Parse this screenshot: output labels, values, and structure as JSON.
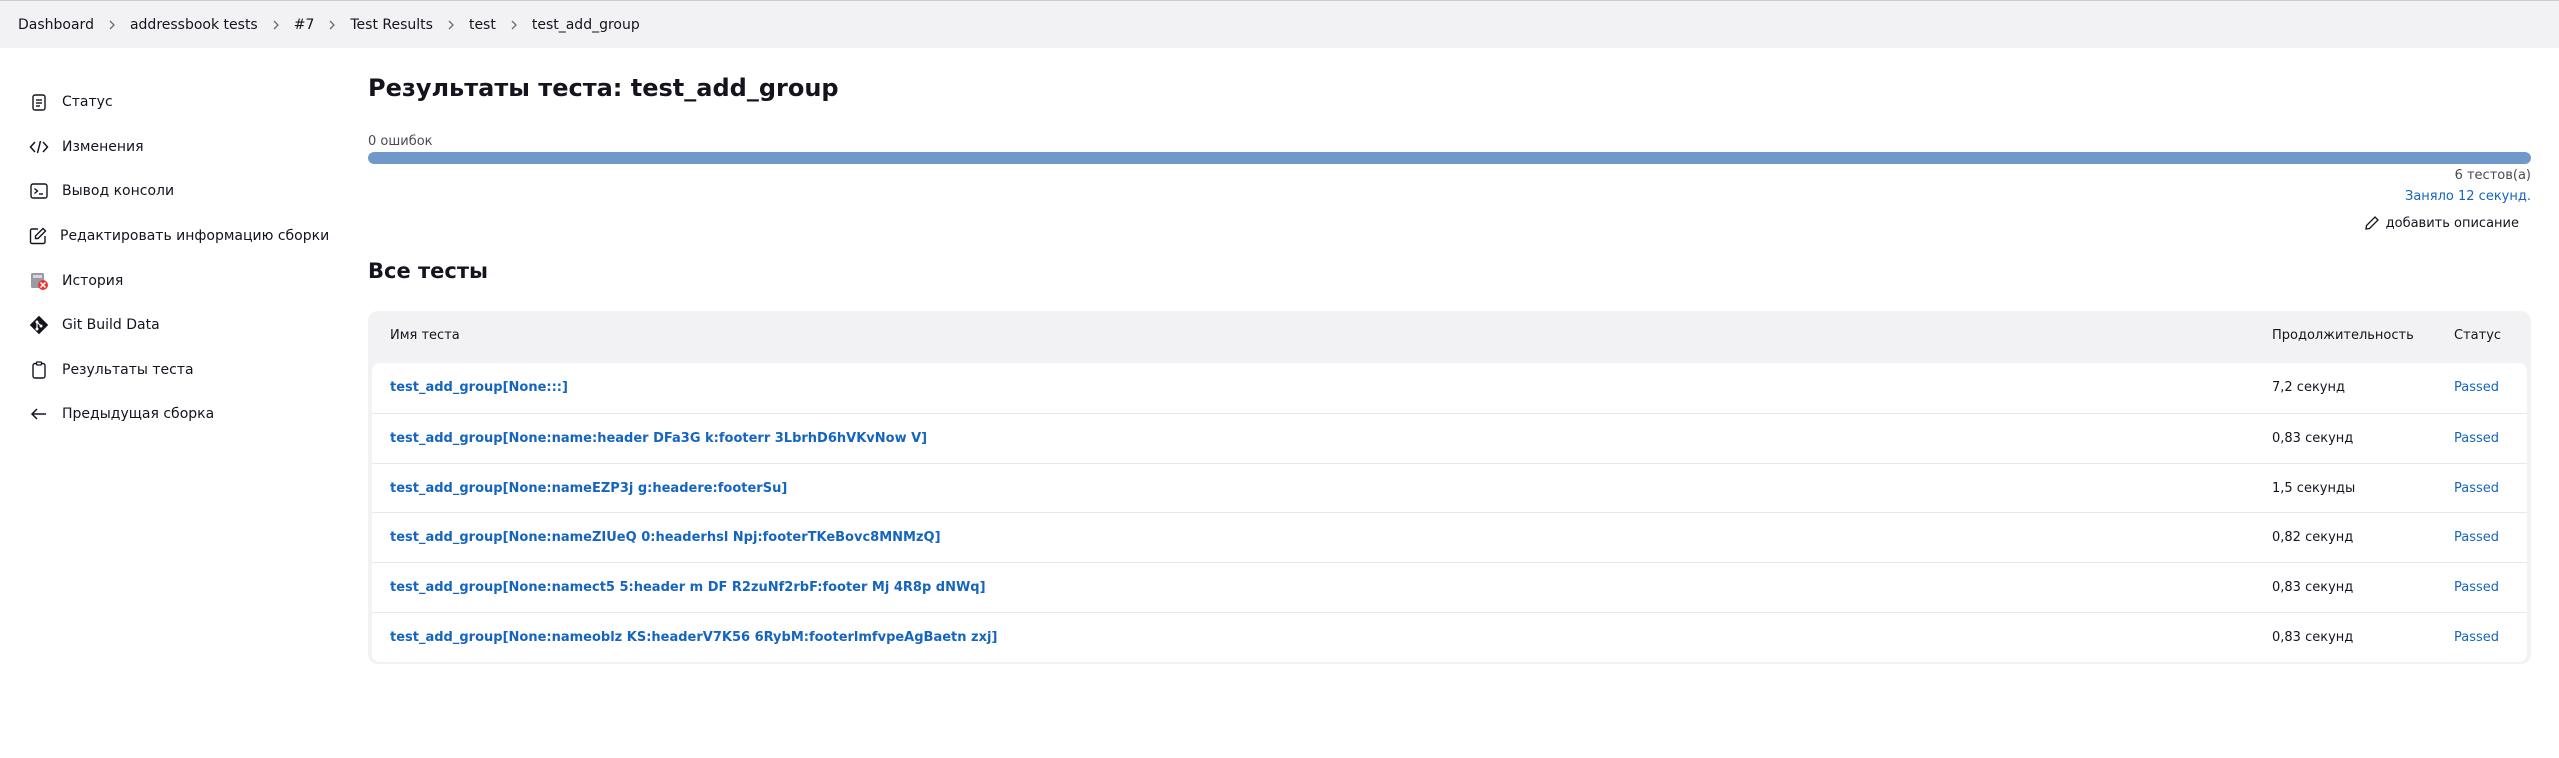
{
  "breadcrumb": [
    "Dashboard",
    "addressbook tests",
    "#7",
    "Test Results",
    "test",
    "test_add_group"
  ],
  "sidebar": {
    "items": [
      {
        "label": "Статус",
        "icon": "clipboard-icon"
      },
      {
        "label": "Изменения",
        "icon": "code-icon"
      },
      {
        "label": "Вывод консоли",
        "icon": "terminal-icon"
      },
      {
        "label": "Редактировать информацию сборки",
        "icon": "edit-square-icon"
      },
      {
        "label": "История",
        "icon": "history-icon"
      },
      {
        "label": "Git Build Data",
        "icon": "git-icon"
      },
      {
        "label": "Результаты теста",
        "icon": "clipboard-list-icon"
      },
      {
        "label": "Предыдущая сборка",
        "icon": "arrow-left-icon"
      }
    ]
  },
  "main": {
    "title": "Результаты теста: test_add_group",
    "failures": "0 ошибок",
    "progress_pass_fraction": 1.0,
    "tests_count": "6 тестов(а)",
    "duration": "Заняло 12 секунд.",
    "add_description": "добавить описание",
    "section_title": "Все тесты"
  },
  "table": {
    "headers": {
      "name": "Имя теста",
      "duration": "Продолжительность",
      "status": "Статус"
    },
    "rows": [
      {
        "name": "test_add_group[None:::]",
        "duration": "7,2 секунд",
        "status": "Passed"
      },
      {
        "name": "test_add_group[None:name:header DFa3G k:footerr 3LbrhD6hVKvNow V]",
        "duration": "0,83 секунд",
        "status": "Passed"
      },
      {
        "name": "test_add_group[None:nameEZP3j g:headere:footerSu]",
        "duration": "1,5 секунды",
        "status": "Passed"
      },
      {
        "name": "test_add_group[None:nameZIUeQ 0:headerhsl Npj:footerTKeBovc8MNMzQ]",
        "duration": "0,82 секунд",
        "status": "Passed"
      },
      {
        "name": "test_add_group[None:namect5 5:header m DF R2zuNf2rbF:footer Mj 4R8p dNWq]",
        "duration": "0,83 секунд",
        "status": "Passed"
      },
      {
        "name": "test_add_group[None:nameoblz KS:headerV7K56 6RybM:footerlmfvpeAgBaetn zxj]",
        "duration": "0,83 секунд",
        "status": "Passed"
      }
    ]
  },
  "colors": {
    "link": "#1565c0",
    "progress_pass": "#7098cb",
    "background_alt": "#f2f2f4"
  }
}
